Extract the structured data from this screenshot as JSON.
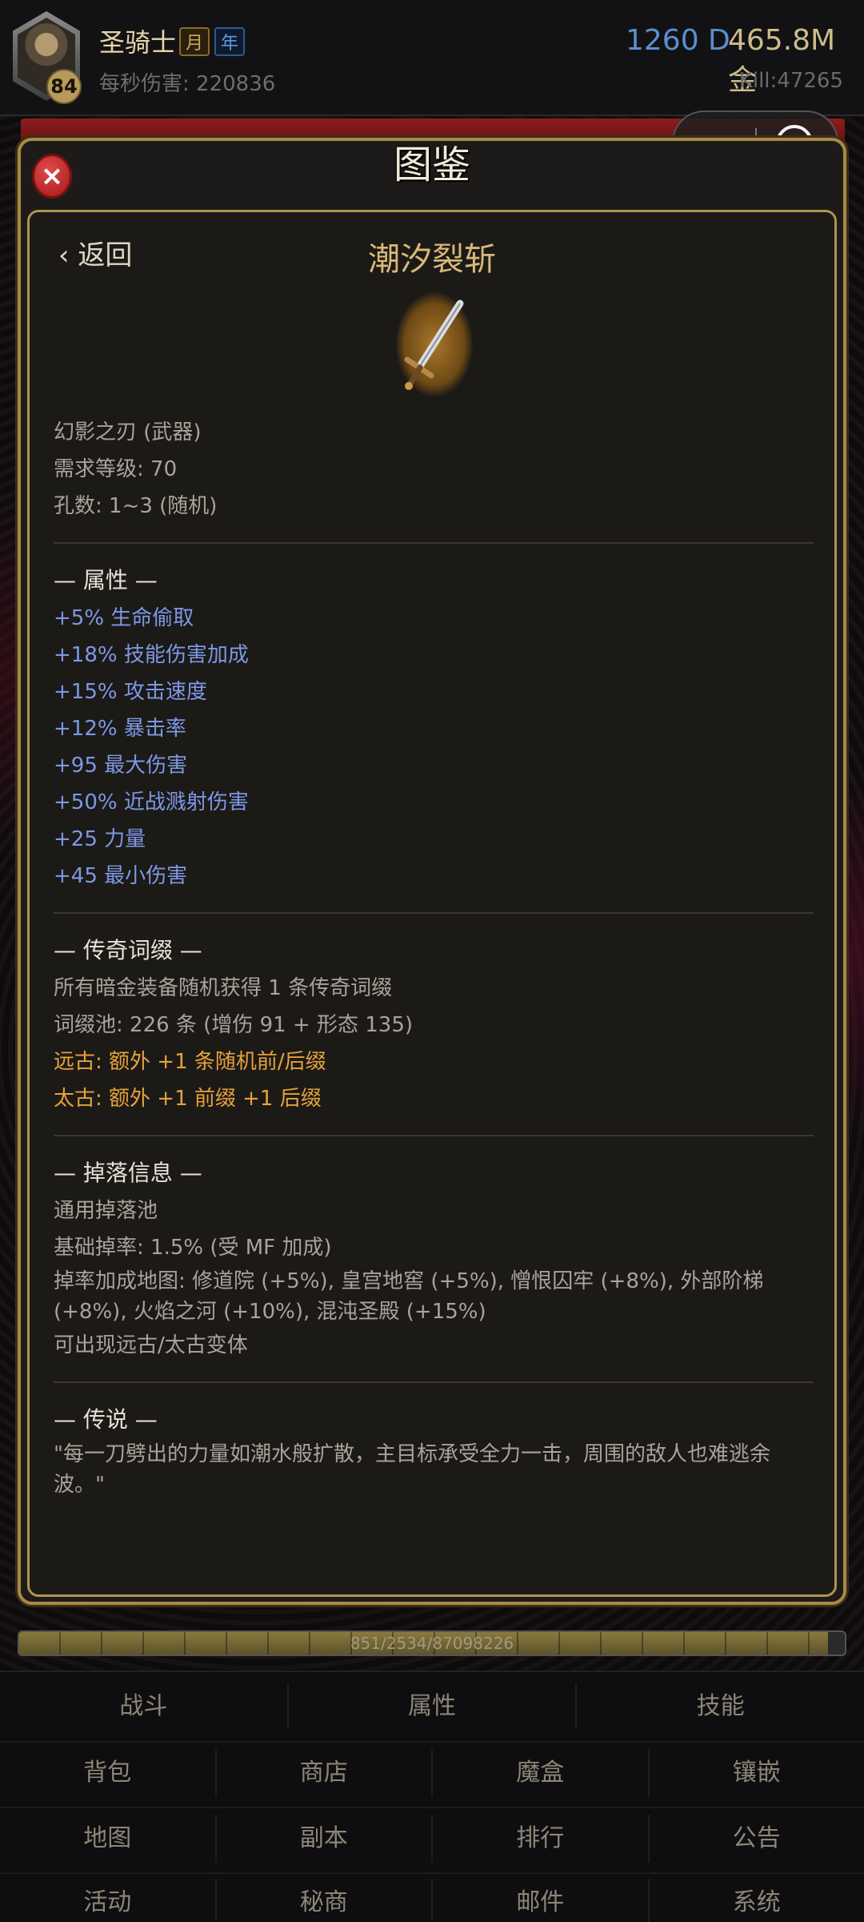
{
  "header": {
    "character_name": "圣骑士",
    "tag_month": "月",
    "tag_year": "年",
    "level": "84",
    "dps_label": "每秒伤害: 220836",
    "gems": "1260 D",
    "gold": "465.8M 金",
    "kills": "Kill:47265"
  },
  "modal": {
    "title": "图鉴",
    "close_label": "×",
    "back_label": "‹ 返回",
    "item_name": "潮汐裂斩",
    "item_icon": "sword-icon",
    "base_info": [
      "幻影之刃 (武器)",
      "需求等级: 70",
      "孔数: 1~3 (随机)"
    ],
    "attributes_title": "— 属性 —",
    "attributes": [
      "+5% 生命偷取",
      "+18% 技能伤害加成",
      "+15% 攻击速度",
      "+12% 暴击率",
      "+95 最大伤害",
      "+50% 近战溅射伤害",
      "+25 力量",
      "+45 最小伤害"
    ],
    "legendary_title": "— 传奇词缀 —",
    "legendary_lines": [
      "所有暗金装备随机获得 1 条传奇词缀",
      "词缀池: 226 条 (增伤 91 + 形态 135)"
    ],
    "legendary_highlights": [
      "远古: 额外 +1 条随机前/后缀",
      "太古: 额外 +1 前缀 +1 后缀"
    ],
    "drop_title": "— 掉落信息 —",
    "drop_lines": [
      "通用掉落池",
      "基础掉率: 1.5% (受 MF 加成)",
      "掉率加成地图: 修道院 (+5%), 皇宫地窖 (+5%), 憎恨囚牢 (+8%), 外部阶梯 (+8%), 火焰之河 (+10%), 混沌圣殿 (+15%)",
      "可出现远古/太古变体"
    ],
    "lore_title": "— 传说 —",
    "lore_text": "\"每一刀劈出的力量如潮水般扩散，主目标承受全力一击，周围的敌人也难逃余波。\""
  },
  "xp_bar": {
    "text": "851/2534/87098226",
    "fill_fraction": 0.98
  },
  "nav": {
    "row1": [
      "战斗",
      "属性",
      "技能"
    ],
    "row2": [
      "背包",
      "商店",
      "魔盒",
      "镶嵌"
    ],
    "row3": [
      "地图",
      "副本",
      "排行",
      "公告"
    ],
    "row4": [
      "活动",
      "秘商",
      "邮件",
      "系统"
    ]
  },
  "colors": {
    "attribute_blue": "#7d98e6",
    "highlight_orange": "#e6a23a",
    "item_name_gold": "#d8b87a",
    "frame_gold": "#a88a45"
  }
}
